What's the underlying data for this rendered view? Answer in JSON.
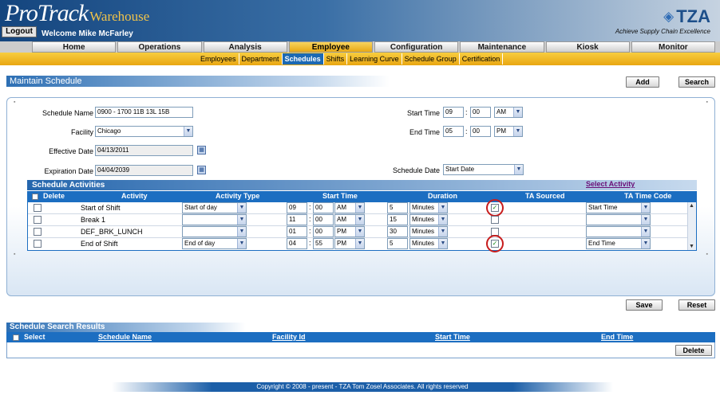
{
  "header": {
    "logo_main": "ProTrack",
    "logo_sub": "Warehouse",
    "logout_label": "Logout",
    "welcome": "Welcome Mike McFarley",
    "brand": "TZA",
    "brand_icon": "tza-diamond-logo",
    "tagline": "Achieve Supply Chain Excellence"
  },
  "nav": {
    "tabs": [
      "Home",
      "Operations",
      "Analysis",
      "Employee",
      "Configuration",
      "Maintenance",
      "Kiosk",
      "Monitor"
    ],
    "active": "Employee",
    "subtabs": [
      "Employees",
      "Department",
      "Schedules",
      "Shifts",
      "Learning Curve",
      "Schedule Group",
      "Certification"
    ],
    "active_sub": "Schedules"
  },
  "page": {
    "title": "Maintain Schedule",
    "add_label": "Add",
    "search_label": "Search",
    "save_label": "Save",
    "reset_label": "Reset"
  },
  "form": {
    "schedule_name_label": "Schedule Name",
    "schedule_name": "0900 - 1700 11B 13L 15B",
    "facility_label": "Facility",
    "facility": "Chicago",
    "effective_label": "Effective Date",
    "effective": "04/13/2011",
    "expiration_label": "Expiration Date",
    "expiration": "04/04/2039",
    "start_time_label": "Start Time",
    "start_hh": "09",
    "start_mm": "00",
    "start_ampm": "AM",
    "end_time_label": "End Time",
    "end_hh": "05",
    "end_mm": "00",
    "end_ampm": "PM",
    "schedule_date_label": "Schedule Date",
    "schedule_date": "Start Date"
  },
  "activities": {
    "title": "Schedule Activities",
    "select_activity": "Select Activity",
    "columns": {
      "delete": "Delete",
      "activity": "Activity",
      "activity_type": "Activity Type",
      "start_time": "Start Time",
      "duration": "Duration",
      "ta_sourced": "TA Sourced",
      "ta_time_code": "TA Time Code"
    },
    "rows": [
      {
        "activity": "Start of Shift",
        "type": "Start of day",
        "hh": "09",
        "mm": "00",
        "ampm": "AM",
        "dur": "5",
        "unit": "Minutes",
        "ta": "✓",
        "code": "Start Time"
      },
      {
        "activity": "Break 1",
        "type": "",
        "hh": "11",
        "mm": "00",
        "ampm": "AM",
        "dur": "15",
        "unit": "Minutes",
        "ta": "",
        "code": ""
      },
      {
        "activity": "DEF_BRK_LUNCH",
        "type": "",
        "hh": "01",
        "mm": "00",
        "ampm": "PM",
        "dur": "30",
        "unit": "Minutes",
        "ta": "",
        "code": ""
      },
      {
        "activity": "End of Shift",
        "type": "End of day",
        "hh": "04",
        "mm": "55",
        "ampm": "PM",
        "dur": "5",
        "unit": "Minutes",
        "ta": "✓",
        "code": "End Time"
      }
    ]
  },
  "results": {
    "title": "Schedule Search Results",
    "columns": {
      "select": "Select",
      "schedule_name": "Schedule Name",
      "facility_id": "Facility Id",
      "start_time": "Start Time",
      "end_time": "End Time"
    },
    "delete_label": "Delete"
  },
  "footer": {
    "copyright": "Copyright © 2008 - present - TZA Tom Zosel Associates. All rights reserved"
  },
  "colors": {
    "nav_active": "#e8a814",
    "header_blue": "#1c6ec1",
    "highlight_circle": "#c71c1c"
  }
}
